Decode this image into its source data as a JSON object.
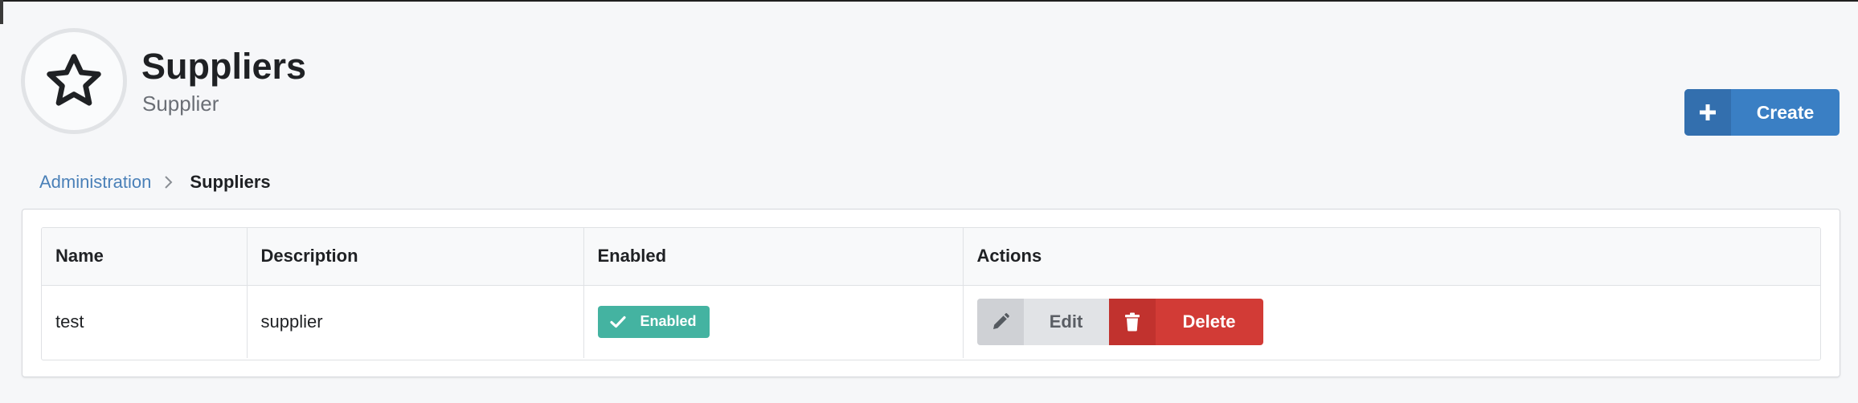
{
  "header": {
    "icon": "star-icon",
    "title": "Suppliers",
    "subtitle": "Supplier"
  },
  "toolbar": {
    "create_label": "Create",
    "create_icon": "plus-icon"
  },
  "breadcrumb": {
    "items": [
      {
        "label": "Administration"
      },
      {
        "label": "Suppliers"
      }
    ],
    "separator_icon": "chevron-right-icon"
  },
  "table": {
    "columns": [
      "Name",
      "Description",
      "Enabled",
      "Actions"
    ],
    "rows": [
      {
        "name": "test",
        "description": "supplier",
        "enabled_label": "Enabled",
        "enabled_icon": "check-icon",
        "actions": {
          "edit_label": "Edit",
          "edit_icon": "pencil-icon",
          "delete_label": "Delete",
          "delete_icon": "trash-icon"
        }
      }
    ]
  },
  "colors": {
    "primary": "#3a7fc4",
    "success": "#44b3a1",
    "danger": "#d23b36",
    "link": "#4a80b8"
  }
}
